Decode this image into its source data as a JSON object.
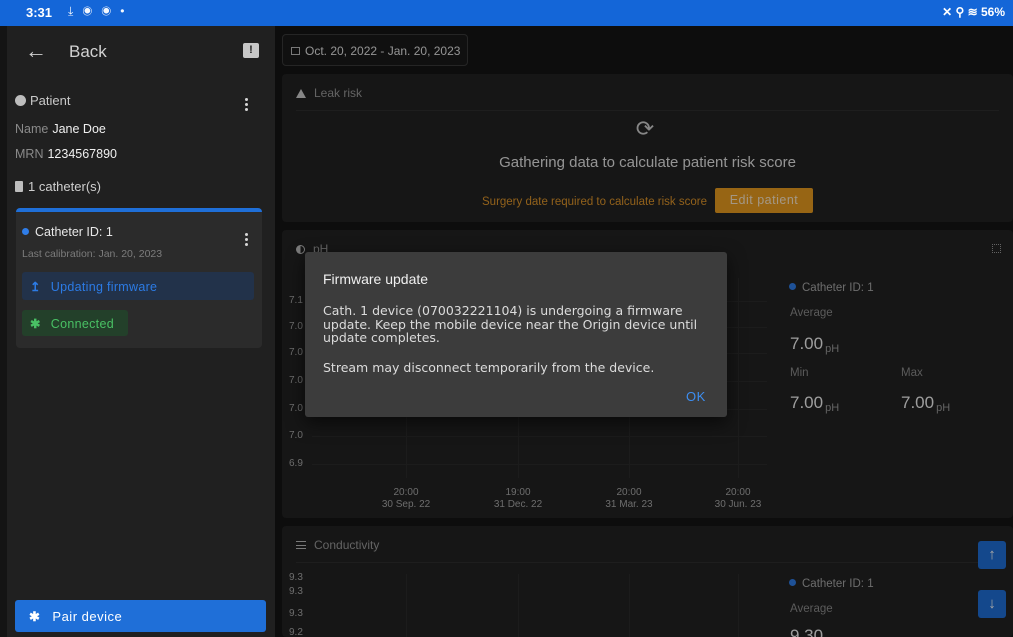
{
  "status_bar": {
    "time": "3:31",
    "notif_icons": "⤓ ◉ ◉ •",
    "right_text": "✕ ⚲ ≋ 56%"
  },
  "sidebar": {
    "back_label": "Back",
    "patient_heading": "Patient",
    "name_label": "Name",
    "name_value": "Jane Doe",
    "mrn_label": "MRN",
    "mrn_value": "1234567890",
    "catheter_count": "1 catheter(s)",
    "catheter_card": {
      "title": "Catheter ID: 1",
      "last_calibration": "Last calibration: Jan. 20, 2023",
      "firmware_status": "Updating firmware",
      "connection_status": "Connected"
    },
    "pair_button": "Pair device"
  },
  "date_range": "Oct. 20, 2022 - Jan. 20, 2023",
  "leak_risk": {
    "heading": "Leak risk",
    "message": "Gathering data to calculate patient risk score",
    "surgery_note": "Surgery date required to calculate risk score",
    "edit_button": "Edit patient"
  },
  "ph_card": {
    "heading": "pH",
    "y_ticks": [
      "7.1",
      "7.0",
      "7.0",
      "7.0",
      "7.0",
      "7.0",
      "6.9"
    ],
    "x_ticks": [
      {
        "time": "20:00",
        "date": "30 Sep. 22"
      },
      {
        "time": "19:00",
        "date": "31 Dec. 22"
      },
      {
        "time": "20:00",
        "date": "31 Mar. 23"
      },
      {
        "time": "20:00",
        "date": "30 Jun. 23"
      }
    ],
    "stats": {
      "catheter": "Catheter ID: 1",
      "average_label": "Average",
      "average_value": "7.00",
      "min_label": "Min",
      "min_value": "7.00",
      "max_label": "Max",
      "max_value": "7.00",
      "unit": "pH"
    }
  },
  "conductivity_card": {
    "heading": "Conductivity",
    "y_ticks": [
      "9.3",
      "9.3",
      "9.3",
      "9.2"
    ],
    "stats": {
      "catheter": "Catheter ID: 1",
      "average_label": "Average",
      "average_value": "9.30"
    }
  },
  "dialog": {
    "title": "Firmware update",
    "body": "Cath. 1 device (070032221104) is undergoing a firmware update. Keep the mobile device near the Origin device until update completes.",
    "body2": "Stream may disconnect temporarily from the device.",
    "ok": "OK"
  }
}
